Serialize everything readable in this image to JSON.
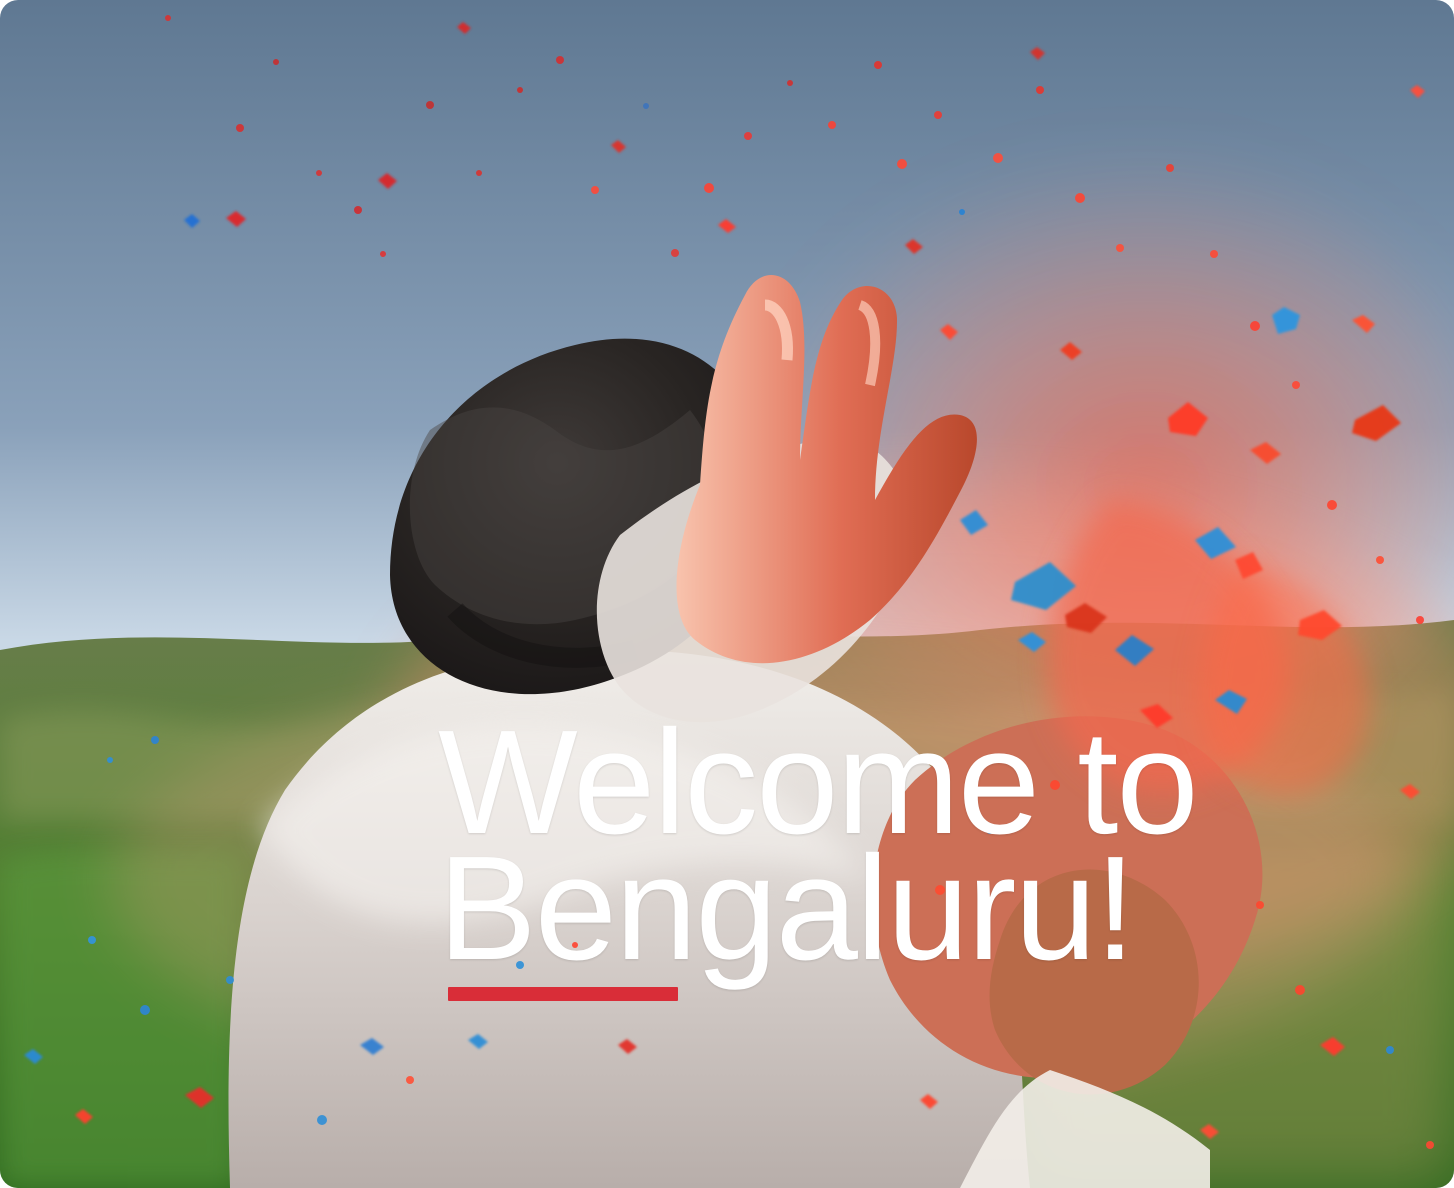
{
  "hero": {
    "title_line_1": "Welcome to",
    "title_line_2": "Bengaluru!",
    "accent_color": "#d92d38",
    "text_color": "#ffffff",
    "scene": "holi-color-powder-splash"
  }
}
